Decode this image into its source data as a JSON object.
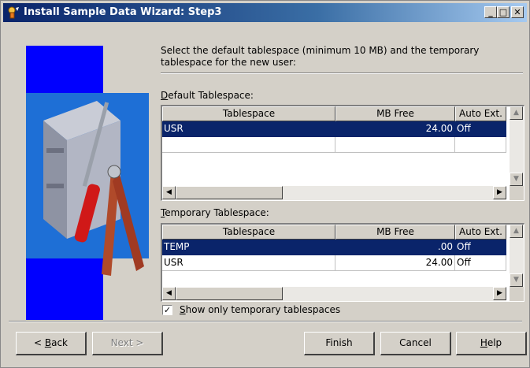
{
  "window": {
    "title": "Install Sample Data Wizard: Step3",
    "controls": {
      "minimize": "_",
      "maximize": "□",
      "close": "✕"
    }
  },
  "intro_text": "Select the default tablespace (minimum 10 MB) and the temporary tablespace for the new user:",
  "default_tablespace": {
    "label_mnemonic": "D",
    "label_rest": "efault Tablespace:",
    "columns": [
      "Tablespace",
      "MB Free",
      "Auto Ext."
    ],
    "rows": [
      {
        "tablespace": "USR",
        "mb_free": "24.00",
        "auto_ext": "Off",
        "selected": true
      }
    ]
  },
  "temporary_tablespace": {
    "label_mnemonic": "T",
    "label_rest": "emporary Tablespace:",
    "columns": [
      "Tablespace",
      "MB Free",
      "Auto Ext."
    ],
    "rows": [
      {
        "tablespace": "TEMP",
        "mb_free": ".00",
        "auto_ext": "Off",
        "selected": true
      },
      {
        "tablespace": "USR",
        "mb_free": "24.00",
        "auto_ext": "Off",
        "selected": false
      }
    ]
  },
  "show_only_temp": {
    "checked": true,
    "label_mnemonic": "S",
    "label_rest": "how only temporary tablespaces"
  },
  "buttons": {
    "back_prefix": "< ",
    "back_mnemonic": "B",
    "back_rest": "ack",
    "next": "Next >",
    "finish": "Finish",
    "cancel": "Cancel",
    "help_mnemonic": "H",
    "help_rest": "elp"
  },
  "colors": {
    "selection": "#0a246a",
    "title_bar_start": "#0a246a",
    "face": "#d4d0c8"
  }
}
